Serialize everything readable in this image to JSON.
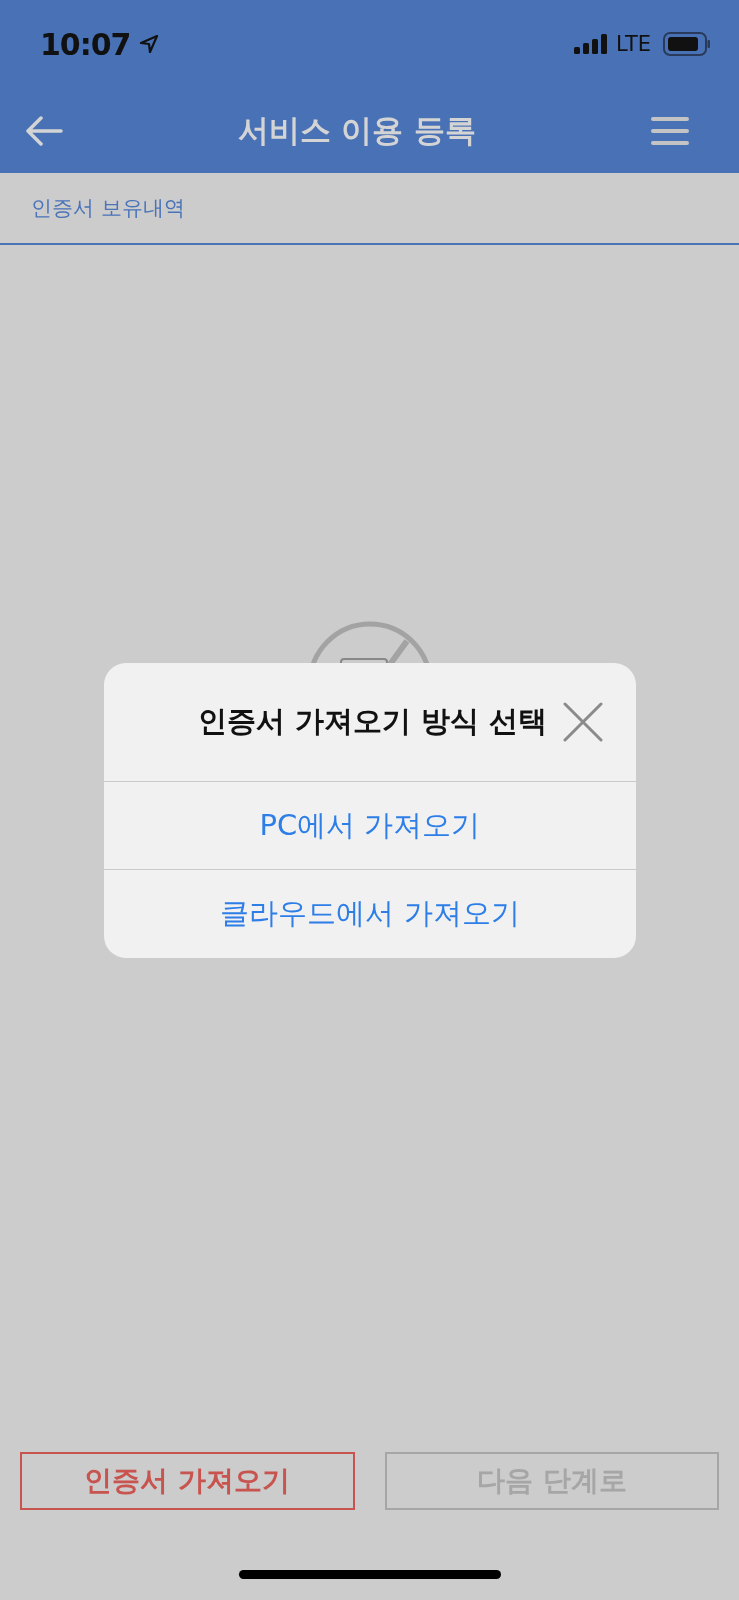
{
  "status_bar": {
    "time": "10:07",
    "network": "LTE"
  },
  "header": {
    "title": "서비스 이용 등록"
  },
  "tabs": [
    {
      "label": "인증서 보유내역",
      "selected": true
    }
  ],
  "dialog": {
    "title": "인증서 가져오기 방식 선택",
    "options": [
      "PC에서 가져오기",
      "클라우드에서 가져오기"
    ]
  },
  "buttons": [
    {
      "label": "인증서 가져오기",
      "disabled": false
    },
    {
      "label": "다음 단계로",
      "disabled": true
    }
  ]
}
